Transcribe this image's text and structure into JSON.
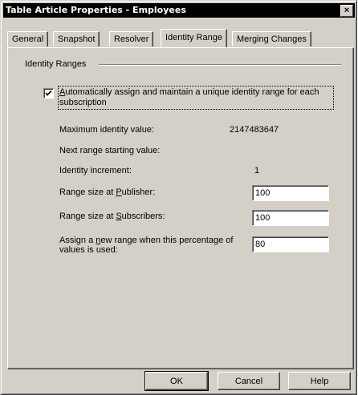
{
  "window": {
    "title": "Table Article Properties - Employees",
    "close_glyph": "×"
  },
  "tabs": [
    {
      "label": "General"
    },
    {
      "label": "Snapshot"
    },
    {
      "label": "Resolver"
    },
    {
      "label": "Identity Range",
      "active": true
    },
    {
      "label": "Merging Changes"
    }
  ],
  "identity_ranges": {
    "group_label": "Identity Ranges",
    "auto_assign": {
      "checked": true,
      "label_prefix": "",
      "label_mnemonic": "A",
      "label_rest": "utomatically assign and maintain a unique identity range for each subscription"
    },
    "max_identity": {
      "label": "Maximum identity value:",
      "value": "2147483647"
    },
    "next_range": {
      "label": "Next range starting value:",
      "value": ""
    },
    "increment": {
      "label": "Identity increment:",
      "value": "1"
    },
    "publisher_range": {
      "label_prefix": "Range size at ",
      "label_mnemonic": "P",
      "label_rest": "ublisher:",
      "value": "100"
    },
    "subscriber_range": {
      "label_prefix": "Range size at ",
      "label_mnemonic": "S",
      "label_rest": "ubscribers:",
      "value": "100"
    },
    "threshold": {
      "label_prefix": "Assign a ",
      "label_mnemonic": "n",
      "label_rest": "ew range when this percentage of",
      "label_line2": "values is used:",
      "value": "80"
    }
  },
  "buttons": {
    "ok": "OK",
    "cancel": "Cancel",
    "help": "Help"
  },
  "icons": {
    "close": "close-icon",
    "check": "check-icon"
  }
}
